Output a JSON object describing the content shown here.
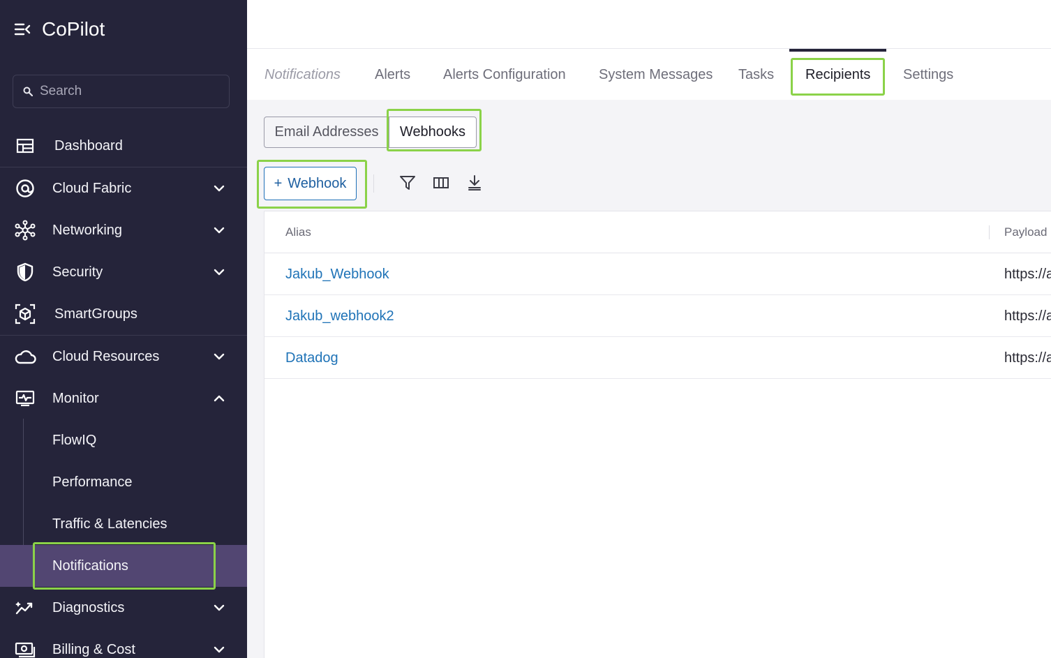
{
  "app": {
    "title": "CoPilot"
  },
  "search": {
    "placeholder": "Search"
  },
  "sidebar": {
    "items": [
      {
        "label": "Dashboard",
        "icon": "dashboard-icon"
      },
      {
        "label": "Cloud Fabric",
        "icon": "cloud-fabric-icon"
      },
      {
        "label": "Networking",
        "icon": "networking-icon"
      },
      {
        "label": "Security",
        "icon": "shield-icon"
      },
      {
        "label": "SmartGroups",
        "icon": "smartgroups-icon"
      },
      {
        "label": "Cloud Resources",
        "icon": "cloud-icon"
      },
      {
        "label": "Monitor",
        "icon": "monitor-icon"
      },
      {
        "label": "Diagnostics",
        "icon": "diagnostics-icon"
      },
      {
        "label": "Billing & Cost",
        "icon": "billing-icon"
      }
    ],
    "monitor_sub": [
      "FlowIQ",
      "Performance",
      "Traffic & Latencies",
      "Notifications"
    ]
  },
  "tabs": [
    "Notifications",
    "Alerts",
    "Alerts Configuration",
    "System Messages",
    "Tasks",
    "Recipients",
    "Settings"
  ],
  "segments": [
    "Email Addresses",
    "Webhooks"
  ],
  "toolbar": {
    "add_label": "Webhook",
    "add_prefix": "+"
  },
  "table": {
    "columns": [
      "Alias",
      "Payload U"
    ],
    "rows": [
      {
        "alias": "Jakub_Webhook",
        "payload": "https://a"
      },
      {
        "alias": "Jakub_webhook2",
        "payload": "https://a"
      },
      {
        "alias": "Datadog",
        "payload": "https://a"
      }
    ]
  },
  "colors": {
    "sidebar_bg": "#25243a",
    "active_sub_bg": "#524672",
    "highlight": "#8bd249",
    "link": "#1f73b7"
  }
}
